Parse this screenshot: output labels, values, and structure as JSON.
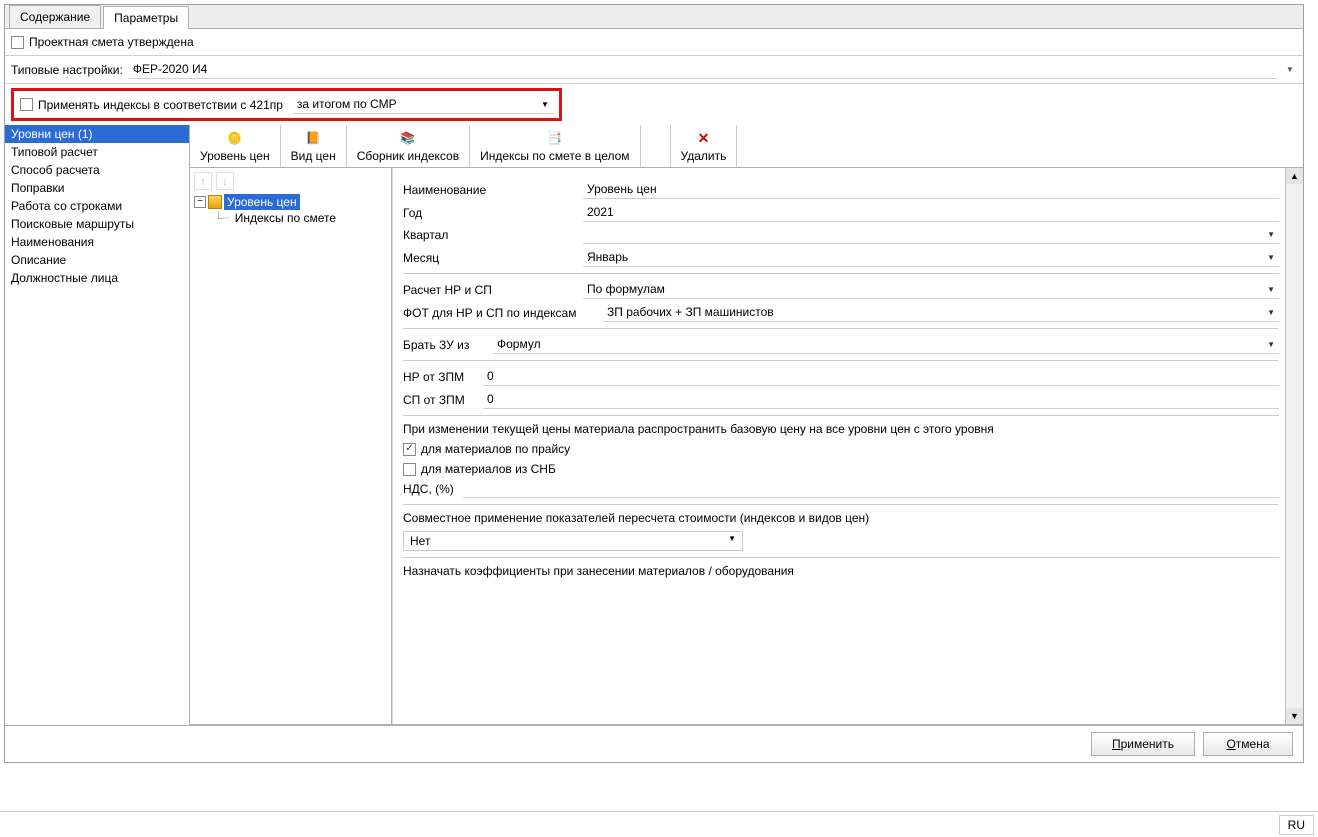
{
  "tabs": {
    "content": "Содержание",
    "params": "Параметры"
  },
  "approved_label": "Проектная смета утверждена",
  "typical": {
    "label": "Типовые настройки:",
    "value": "ФЕР-2020 И4"
  },
  "apply421": {
    "label": "Применять индексы в соответствии с 421пр",
    "value": "за итогом по СМР"
  },
  "toolbar": {
    "level": "Уровень цен",
    "view": "Вид цен",
    "collection": "Сборник индексов",
    "indexes_whole": "Индексы по смете в целом",
    "delete": "Удалить"
  },
  "sidebar": {
    "items": [
      "Уровни цен (1)",
      "Типовой расчет",
      "Способ расчета",
      "Поправки",
      "Работа со строками",
      "Поисковые маршруты",
      "Наименования",
      "Описание",
      "Должностные лица"
    ],
    "selected": 0
  },
  "tree": {
    "root": "Уровень цен",
    "child": "Индексы по смете"
  },
  "detail": {
    "name_label": "Наименование",
    "name_value": "Уровень цен",
    "year_label": "Год",
    "year_value": "2021",
    "quarter_label": "Квартал",
    "quarter_value": "",
    "month_label": "Месяц",
    "month_value": "Январь",
    "nr_sp_label": "Расчет НР и СП",
    "nr_sp_value": "По формулам",
    "fot_label": "ФОТ для НР и СП по индексам",
    "fot_value": "ЗП рабочих + ЗП машинистов",
    "zu_label": "Брать ЗУ из",
    "zu_value": "Формул",
    "nr_zpm_label": "НР от ЗПМ",
    "nr_zpm_value": "0",
    "sp_zpm_label": "СП от ЗПМ",
    "sp_zpm_value": "0",
    "spread_text": "При изменении текущей цены материала распространить базовую цену на все уровни цен с этого уровня",
    "chk_price": "для материалов по прайсу",
    "chk_snb": "для материалов из СНБ",
    "nds_label": "НДС, (%)",
    "nds_value": "",
    "combined_label": "Совместное применение показателей пересчета стоимости (индексов и видов цен)",
    "combined_value": "Нет",
    "assign_label": "Назначать коэффициенты при занесении материалов / оборудования"
  },
  "footer": {
    "apply": "рименить",
    "apply_accel": "П",
    "cancel": "тмена",
    "cancel_accel": "О"
  },
  "status": {
    "lang": "RU"
  }
}
